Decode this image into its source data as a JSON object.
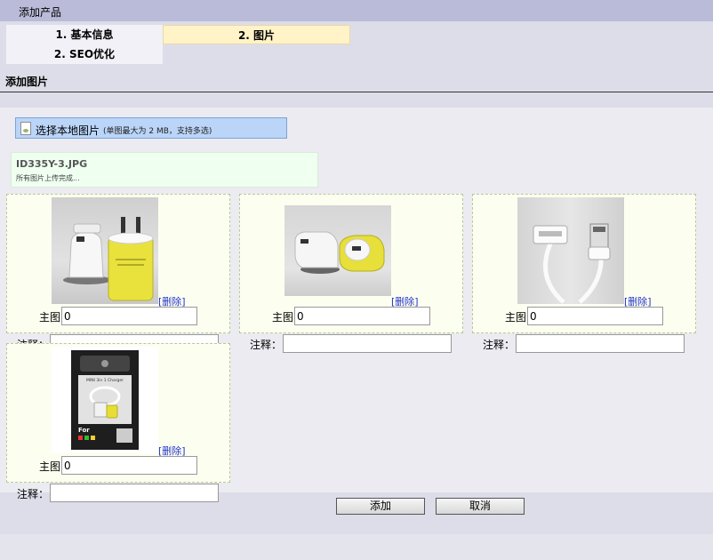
{
  "window": {
    "title": "添加产品"
  },
  "tabs": [
    {
      "label": "1. 基本信息"
    },
    {
      "label": "2. 图片"
    },
    {
      "label": "2. SEO优化"
    }
  ],
  "section": {
    "title": "添加图片"
  },
  "upload": {
    "button_label": "选择本地图片",
    "note": "(单图最大为 2 MB，支持多选)"
  },
  "status": {
    "filename": "ID335Y-3.JPG",
    "message": "所有图片上传完成..."
  },
  "cards": [
    {
      "delete_label": "[删除]",
      "main_label": "主图",
      "main_value": "0",
      "note_label": "注释：",
      "note_value": ""
    },
    {
      "delete_label": "[删除]",
      "main_label": "主图",
      "main_value": "0",
      "note_label": "注释：",
      "note_value": ""
    },
    {
      "delete_label": "[删除]",
      "main_label": "主图",
      "main_value": "0",
      "note_label": "注释：",
      "note_value": ""
    },
    {
      "delete_label": "[删除]",
      "main_label": "主图",
      "main_value": "0",
      "note_label": "注释：",
      "note_value": ""
    }
  ],
  "packaging_photo": {
    "title": "MINI 3in 1 Charger",
    "for_text": "For"
  },
  "buttons": {
    "add": "添加",
    "cancel": "取消"
  }
}
